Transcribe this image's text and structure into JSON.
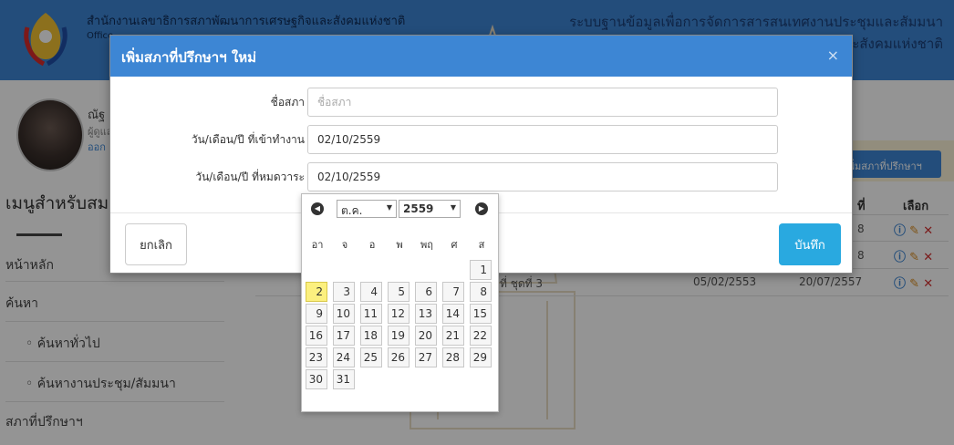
{
  "header": {
    "title": "สำนักงานเลขาธิการสภาพัฒนาการเศรษฐกิจและสังคมแห่งชาติ",
    "subtitle": "Office",
    "right_line1": "ระบบฐานข้อมูลเพื่อการจัดการสารสนเทศงานประชุมและสัมมนา",
    "right_line2": "และสังคมแห่งชาติ"
  },
  "profile": {
    "name": "ณัฐ",
    "role": "ผู้ดูแล",
    "logout": "ออก"
  },
  "sidebar": {
    "title": "เมนูสำหรับสมาชิก",
    "items": [
      {
        "label": "หน้าหลัก"
      },
      {
        "label": "ค้นหา"
      },
      {
        "label": "ค้นหาทั่วไป"
      },
      {
        "label": "ค้นหางานประชุม/สัมมนา"
      },
      {
        "label": "สภาที่ปรึกษาฯ"
      }
    ]
  },
  "content": {
    "add_button": "เพิ่มสภาที่ปรึกษาฯ",
    "col_select": "เลือก",
    "col_date": "ที่",
    "rows": [
      {
        "num": "",
        "name": "",
        "start": "",
        "end": "8"
      },
      {
        "num": "",
        "name": "",
        "start": "",
        "end": "8"
      },
      {
        "num": "3",
        "name": "ที่ ชุดที่ 3",
        "start": "05/02/2553",
        "end": "20/07/2557"
      }
    ]
  },
  "modal": {
    "title": "เพิ่มสภาที่ปรึกษาฯ ใหม่",
    "close": "×",
    "fields": {
      "name_label": "ชื่อสภา",
      "name_placeholder": "ชื่อสภา",
      "name_value": "",
      "start_label": "วัน/เดือน/ปี ที่เข้าทำงาน",
      "start_value": "02/10/2559",
      "end_label": "วัน/เดือน/ปี ที่หมดวาระ",
      "end_value": "02/10/2559"
    },
    "cancel": "ยกเลิก",
    "save": "บันทึก"
  },
  "datepicker": {
    "prev_icon": "◀",
    "next_icon": "▶",
    "month": "ต.ค.",
    "year": "2559",
    "weekdays": [
      "อา",
      "จ",
      "อ",
      "พ",
      "พฤ",
      "ศ",
      "ส"
    ],
    "highlighted_day": "2",
    "days": [
      "1",
      "2",
      "3",
      "4",
      "5",
      "6",
      "7",
      "8",
      "9",
      "10",
      "11",
      "12",
      "13",
      "14",
      "15",
      "16",
      "17",
      "18",
      "19",
      "20",
      "21",
      "22",
      "23",
      "24",
      "25",
      "26",
      "27",
      "28",
      "29",
      "30",
      "31"
    ],
    "first_weekday_index": 6
  },
  "colors": {
    "brand": "#3d86d4",
    "save": "#29a9e0",
    "highlight": "#fcf07f",
    "delete": "#d32f2f"
  }
}
